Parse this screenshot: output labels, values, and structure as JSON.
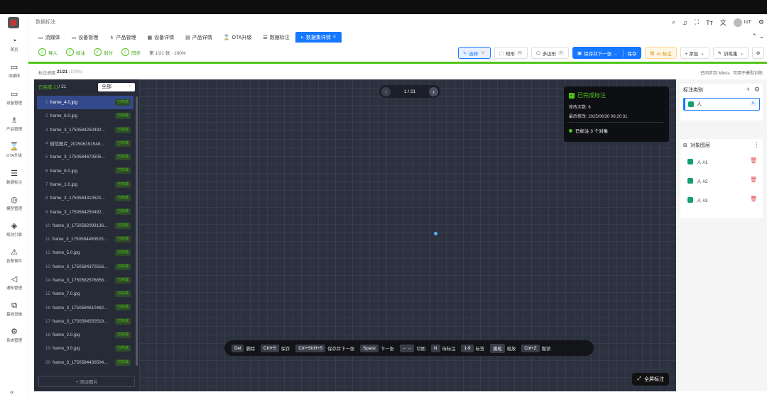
{
  "header": {
    "breadcrumb": "数据标注",
    "user": "IoT",
    "icons": [
      "search-icon",
      "bell-icon",
      "fullscreen-icon",
      "font-size-icon",
      "translate-icon",
      "avatar",
      "settings-icon"
    ]
  },
  "sidebar": {
    "items": [
      {
        "name": "home",
        "icon": "◔",
        "label": "首页"
      },
      {
        "name": "stream",
        "icon": "▭",
        "label": "流媒体"
      },
      {
        "name": "device",
        "icon": "▭",
        "label": "设备管理"
      },
      {
        "name": "product",
        "icon": "♗",
        "label": "产品管理"
      },
      {
        "name": "ota",
        "icon": "⌛",
        "label": "OTA升级"
      },
      {
        "name": "data",
        "icon": "☰",
        "label": "数据标注"
      },
      {
        "name": "model",
        "icon": "◎",
        "label": "模型管理"
      },
      {
        "name": "rules",
        "icon": "◈",
        "label": "规则引擎"
      },
      {
        "name": "alarm",
        "icon": "⚠",
        "label": "告警事件"
      },
      {
        "name": "notify",
        "icon": "◁",
        "label": "通知管理"
      },
      {
        "name": "infra",
        "icon": "⧉",
        "label": "基础设施"
      },
      {
        "name": "system",
        "icon": "⚙",
        "label": "系统管理"
      }
    ],
    "collapse": "«"
  },
  "tabs": [
    {
      "label": "流媒体",
      "icon": "▭"
    },
    {
      "label": "设备管理",
      "icon": "▭"
    },
    {
      "label": "产品管理",
      "icon": "♗"
    },
    {
      "label": "设备详情",
      "icon": "▦"
    },
    {
      "label": "产品详情",
      "icon": "▤"
    },
    {
      "label": "OTA升级",
      "icon": "⌛"
    },
    {
      "label": "数据标注",
      "icon": "☰"
    },
    {
      "label": "数据集详情",
      "icon": "⟀",
      "close": "×",
      "active": true
    }
  ],
  "tabs_more": "⌃ ⌄",
  "toolbar": {
    "steps": [
      "导入",
      "标注",
      "划分",
      "同步"
    ],
    "progress": "第 1/21 张 · 100%",
    "tool_select": "选择",
    "tool_select_key": "V",
    "tool_rect": "矩形",
    "tool_rect_key": "R",
    "tool_poly": "多边形",
    "tool_poly_key": "P",
    "save_next": "保存并下一张 →",
    "save": "保存",
    "ai": "AI 标注",
    "add": "+ 添加",
    "train": "训练集"
  },
  "statusbar": {
    "left_prefix": "标注进度 ",
    "left_value": "21/21",
    "left_pct": "(100%)",
    "right": "已同步到 Minio，可用于模型训练"
  },
  "filelist": {
    "done_prefix": "已完成 21",
    "done_total": " / 21",
    "filter": "全部",
    "items": [
      {
        "n": "1",
        "name": "frame_4.0.jpg",
        "status": "已完成"
      },
      {
        "n": "2",
        "name": "frame_6.0.jpg",
        "status": "已完成"
      },
      {
        "n": "3",
        "name": "frame_3_1750584250492...",
        "status": "已完成"
      },
      {
        "n": "4",
        "name": "微信图片_202506191548...",
        "status": "已完成"
      },
      {
        "n": "5",
        "name": "frame_3_1750584670505...",
        "status": "已完成"
      },
      {
        "n": "6",
        "name": "frame_8.0.jpg",
        "status": "已完成"
      },
      {
        "n": "7",
        "name": "frame_1.0.jpg",
        "status": "已完成"
      },
      {
        "n": "8",
        "name": "frame_3_1750584310521...",
        "status": "已完成"
      },
      {
        "n": "9",
        "name": "frame_3_1750584250492...",
        "status": "已完成"
      },
      {
        "n": "10",
        "name": "frame_3_1750582093136...",
        "status": "已完成"
      },
      {
        "n": "11",
        "name": "frame_3_1750584490520...",
        "status": "已完成"
      },
      {
        "n": "12",
        "name": "frame_5.0.jpg",
        "status": "已完成"
      },
      {
        "n": "13",
        "name": "frame_3_1750584370516...",
        "status": "已完成"
      },
      {
        "n": "14",
        "name": "frame_3_1750582576856...",
        "status": "已完成"
      },
      {
        "n": "15",
        "name": "frame_7.0.jpg",
        "status": "已完成"
      },
      {
        "n": "16",
        "name": "frame_3_1750584610482...",
        "status": "已完成"
      },
      {
        "n": "17",
        "name": "frame_3_1750584550519...",
        "status": "已完成"
      },
      {
        "n": "18",
        "name": "frame_2.0.jpg",
        "status": "已完成"
      },
      {
        "n": "19",
        "name": "frame_3.0.jpg",
        "status": "已完成"
      },
      {
        "n": "20",
        "name": "frame_3_1750584430504...",
        "status": "已完成"
      }
    ],
    "add": "+ 添加图片"
  },
  "canvas": {
    "pager": "1 / 21",
    "card": {
      "title": "已完成标注",
      "edits": "修改次数: 6",
      "modified": "最后修改: 2025/06/30 08:20:31",
      "count": "已标注 3 个对象"
    },
    "shortcuts": [
      {
        "k": "Del",
        "d": "删除"
      },
      {
        "k": "Ctrl+S",
        "d": "保存"
      },
      {
        "k": "Ctrl+Shift+S",
        "d": "保存并下一张"
      },
      {
        "k": "Space",
        "d": "下一张"
      },
      {
        "k": "←→",
        "d": "切图"
      },
      {
        "k": "N",
        "d": "待标注"
      },
      {
        "k": "1-9",
        "d": "标签"
      },
      {
        "k": "滚轮",
        "d": "缩放"
      },
      {
        "k": "Ctrl+Z",
        "d": "撤销"
      }
    ],
    "fullscreen": "全屏标注"
  },
  "rpanel": {
    "categories_title": "标注类别",
    "category": {
      "name": "人",
      "count": "0",
      "color": "#13a06a"
    },
    "layers_title": "对象图层",
    "layers": [
      "人 #1",
      "人 #2",
      "人 #3"
    ]
  },
  "colors": {
    "accent": "#1677ff",
    "success": "#52c41a",
    "danger": "#e5484d",
    "canvas": "#2c3140"
  }
}
